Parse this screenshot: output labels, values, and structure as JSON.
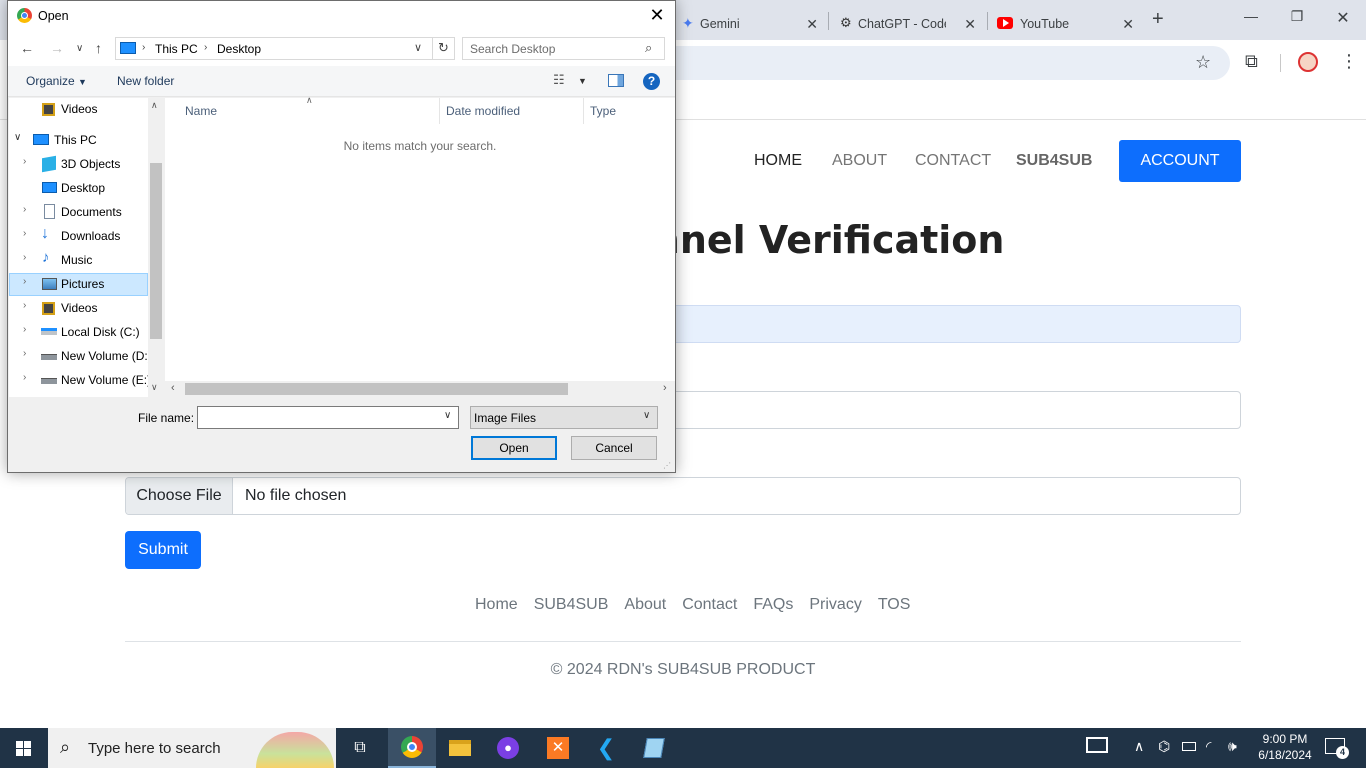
{
  "browser": {
    "tabs": [
      {
        "title": "Gemini"
      },
      {
        "title": "ChatGPT - Code"
      },
      {
        "title": "YouTube"
      }
    ],
    "new_tab_symbol": "+",
    "colors": {
      "tabstrip": "#dfe3eb",
      "omnibox": "#e9eef6"
    }
  },
  "site": {
    "nav": {
      "home": "HOME",
      "about": "ABOUT",
      "contact": "CONTACT",
      "brand": "SUB4SUB",
      "account": "ACCOUNT"
    },
    "heading": "YouTube Channel Verification",
    "file_input": {
      "button": "Choose File",
      "status": "No file chosen"
    },
    "submit": "Submit",
    "footer_links": [
      "Home",
      "SUB4SUB",
      "About",
      "Contact",
      "FAQs",
      "Privacy",
      "TOS"
    ],
    "copyright": "© 2024 RDN's SUB4SUB PRODUCT",
    "colors": {
      "primary": "#0d6efd"
    }
  },
  "dialog": {
    "title": "Open",
    "address": {
      "root": "This PC",
      "folder": "Desktop"
    },
    "search_placeholder": "Search Desktop",
    "toolbar": {
      "organize": "Organize",
      "new_folder": "New folder"
    },
    "tree": [
      {
        "label": "Videos",
        "icon": "video-folder-icon"
      },
      {
        "label": "This PC",
        "icon": "computer-icon"
      },
      {
        "label": "3D Objects",
        "icon": "3d-objects-icon"
      },
      {
        "label": "Desktop",
        "icon": "desktop-icon"
      },
      {
        "label": "Documents",
        "icon": "documents-icon"
      },
      {
        "label": "Downloads",
        "icon": "downloads-icon"
      },
      {
        "label": "Music",
        "icon": "music-icon"
      },
      {
        "label": "Pictures",
        "icon": "pictures-icon"
      },
      {
        "label": "Videos",
        "icon": "video-folder-icon"
      },
      {
        "label": "Local Disk (C:)",
        "icon": "disk-icon"
      },
      {
        "label": "New Volume (D:)",
        "icon": "drive-icon"
      },
      {
        "label": "New Volume (E:)",
        "icon": "drive-icon"
      }
    ],
    "selected_tree_item": "Pictures",
    "columns": [
      "Name",
      "Date modified",
      "Type"
    ],
    "empty_message": "No items match your search.",
    "file_name_label": "File name:",
    "file_name_value": "",
    "file_type": "Image Files",
    "open_button": "Open",
    "cancel_button": "Cancel"
  },
  "taskbar": {
    "search_placeholder": "Type here to search",
    "time": "9:00 PM",
    "date": "6/18/2024",
    "notification_count": "4"
  }
}
